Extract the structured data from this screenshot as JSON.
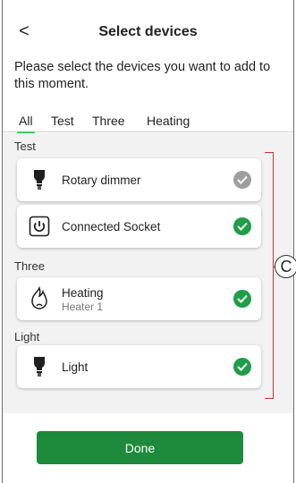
{
  "header": {
    "back_icon": "chevron-left-icon",
    "back_glyph": "<",
    "title": "Select devices"
  },
  "subtitle": "Please select the devices you want to add to this moment.",
  "tabs": [
    {
      "label": "All",
      "active": true
    },
    {
      "label": "Test",
      "active": false
    },
    {
      "label": "Three",
      "active": false
    },
    {
      "label": "Heating",
      "active": false
    }
  ],
  "sections": [
    {
      "label": "Test",
      "devices": [
        {
          "name": "Rotary dimmer",
          "icon": "bulb-icon",
          "checked": "disabled"
        },
        {
          "name": "Connected Socket",
          "icon": "socket-icon",
          "checked": "selected"
        }
      ]
    },
    {
      "label": "Three",
      "devices": [
        {
          "name": "Heating",
          "subtitle": "Heater 1",
          "icon": "flame-icon",
          "checked": "selected"
        }
      ]
    },
    {
      "label": "Light",
      "devices": [
        {
          "name": "Light",
          "icon": "bulb-icon",
          "checked": "selected"
        }
      ]
    }
  ],
  "callout": {
    "label": "C"
  },
  "done_label": "Done",
  "colors": {
    "accent": "#3dcd58",
    "primary_button": "#1e8a3b",
    "check_green": "#3dcd58",
    "check_grey": "#9e9e9e",
    "callout_line": "#c0392b"
  }
}
